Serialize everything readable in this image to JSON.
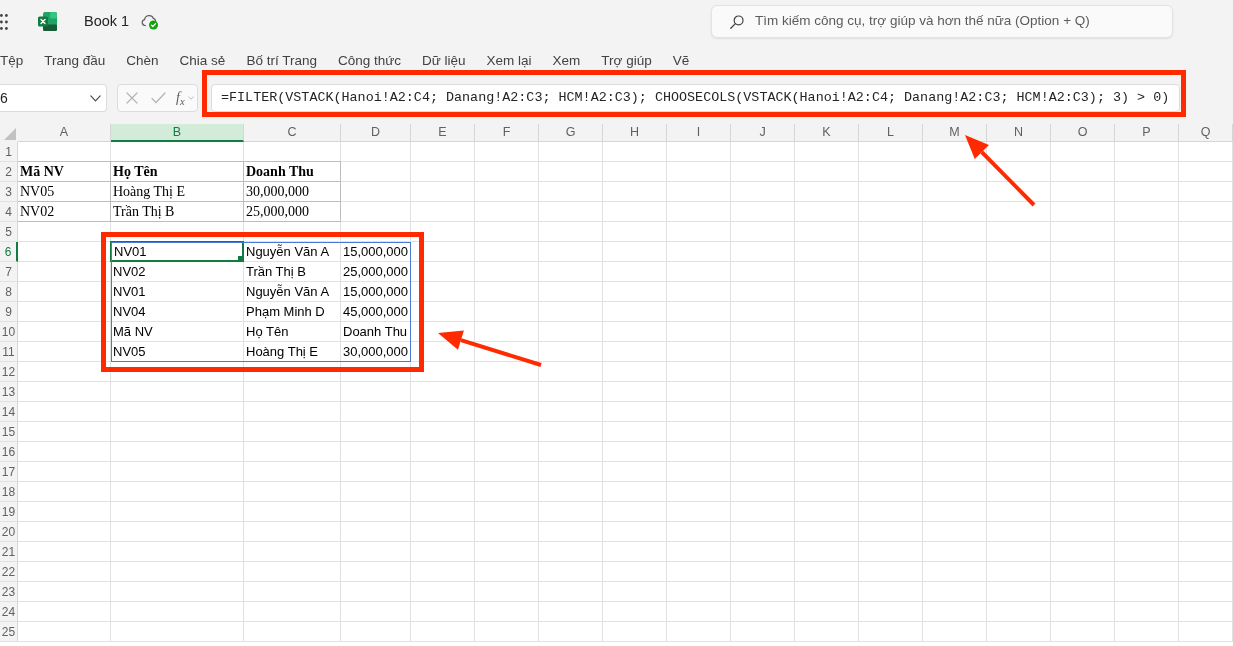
{
  "app": {
    "title": "Book 1"
  },
  "search": {
    "placeholder": "Tìm kiếm công cụ, trợ giúp và hơn thế nữa (Option + Q)"
  },
  "ribbon_tabs": [
    {
      "label": "Tệp",
      "selected": false
    },
    {
      "label": "Trang đầu",
      "selected": false
    },
    {
      "label": "Chèn",
      "selected": false
    },
    {
      "label": "Chia sẻ",
      "selected": false
    },
    {
      "label": "Bố trí Trang",
      "selected": false
    },
    {
      "label": "Công thức",
      "selected": false
    },
    {
      "label": "Dữ liệu",
      "selected": false
    },
    {
      "label": "Xem lại",
      "selected": false
    },
    {
      "label": "Xem",
      "selected": false
    },
    {
      "label": "Trợ giúp",
      "selected": false
    },
    {
      "label": "Vẽ",
      "selected": false
    }
  ],
  "formula_bar": {
    "name_box": "6",
    "function_button": "f$_{x}$",
    "formula": "=FILTER(VSTACK(Hanoi!A2:C4; Danang!A2:C3; HCM!A2:C3); CHOOSECOLS(VSTACK(Hanoi!A2:C4; Danang!A2:C3; HCM!A2:C3); 3) > 0)"
  },
  "sheet": {
    "columns": [
      {
        "label": "A",
        "selected": false
      },
      {
        "label": "B",
        "selected": true
      },
      {
        "label": "C",
        "selected": false
      },
      {
        "label": "D",
        "selected": false
      },
      {
        "label": "E",
        "selected": false
      },
      {
        "label": "F",
        "selected": false
      },
      {
        "label": "G",
        "selected": false
      },
      {
        "label": "H",
        "selected": false
      },
      {
        "label": "I",
        "selected": false
      },
      {
        "label": "J",
        "selected": false
      },
      {
        "label": "K",
        "selected": false
      },
      {
        "label": "L",
        "selected": false
      },
      {
        "label": "M",
        "selected": false
      },
      {
        "label": "N",
        "selected": false
      },
      {
        "label": "O",
        "selected": false
      },
      {
        "label": "P",
        "selected": false
      },
      {
        "label": "Q",
        "selected": false
      }
    ],
    "rows": [
      {
        "label": "1",
        "selected": false
      },
      {
        "label": "2",
        "selected": false
      },
      {
        "label": "3",
        "selected": false
      },
      {
        "label": "4",
        "selected": false
      },
      {
        "label": "5",
        "selected": false
      },
      {
        "label": "6",
        "selected": true
      },
      {
        "label": "7",
        "selected": false
      },
      {
        "label": "8",
        "selected": false
      },
      {
        "label": "9",
        "selected": false
      },
      {
        "label": "10",
        "selected": false
      },
      {
        "label": "11",
        "selected": false
      },
      {
        "label": "12",
        "selected": false
      },
      {
        "label": "13",
        "selected": false
      },
      {
        "label": "14",
        "selected": false
      },
      {
        "label": "15",
        "selected": false
      },
      {
        "label": "16",
        "selected": false
      },
      {
        "label": "17",
        "selected": false
      },
      {
        "label": "18",
        "selected": false
      },
      {
        "label": "19",
        "selected": false
      },
      {
        "label": "20",
        "selected": false
      },
      {
        "label": "21",
        "selected": false
      },
      {
        "label": "22",
        "selected": false
      },
      {
        "label": "23",
        "selected": false
      },
      {
        "label": "24",
        "selected": false
      },
      {
        "label": "25",
        "selected": false
      }
    ],
    "source_table": {
      "header": [
        {
          "text": "Mã NV",
          "selected": false
        },
        {
          "text": "Họ Tên",
          "selected": false
        },
        {
          "text": "Doanh Thu",
          "selected": false
        }
      ],
      "rows": [
        [
          {
            "text": "NV05",
            "selected": false
          },
          {
            "text": "Hoàng Thị E",
            "selected": false
          },
          {
            "text": "30,000,000",
            "selected": false
          }
        ],
        [
          {
            "text": "NV02",
            "selected": false
          },
          {
            "text": "Trần Thị B",
            "selected": false
          },
          {
            "text": "25,000,000",
            "selected": false
          }
        ]
      ]
    },
    "spill_range": {
      "rows": [
        [
          {
            "text": "NV01",
            "selected": true
          },
          {
            "text": "Nguyễn Văn A",
            "selected": false
          },
          {
            "text": "15,000,000",
            "selected": false
          }
        ],
        [
          {
            "text": "NV02",
            "selected": false
          },
          {
            "text": "Trần Thị B",
            "selected": false
          },
          {
            "text": "25,000,000",
            "selected": false
          }
        ],
        [
          {
            "text": "NV01",
            "selected": false
          },
          {
            "text": "Nguyễn Văn A",
            "selected": false
          },
          {
            "text": "15,000,000",
            "selected": false
          }
        ],
        [
          {
            "text": "NV04",
            "selected": false
          },
          {
            "text": "Phạm Minh D",
            "selected": false
          },
          {
            "text": "45,000,000",
            "selected": false
          }
        ],
        [
          {
            "text": "Mã NV",
            "selected": false
          },
          {
            "text": "Họ Tên",
            "selected": false
          },
          {
            "text": "Doanh Thu",
            "selected": false
          }
        ],
        [
          {
            "text": "NV05",
            "selected": false
          },
          {
            "text": "Hoàng Thị E",
            "selected": false
          },
          {
            "text": "30,000,000",
            "selected": false
          }
        ]
      ]
    }
  },
  "annotations": [
    {
      "kind": "frame"
    },
    {
      "kind": "arrow"
    },
    {
      "kind": "frame"
    },
    {
      "kind": "arrow"
    }
  ]
}
